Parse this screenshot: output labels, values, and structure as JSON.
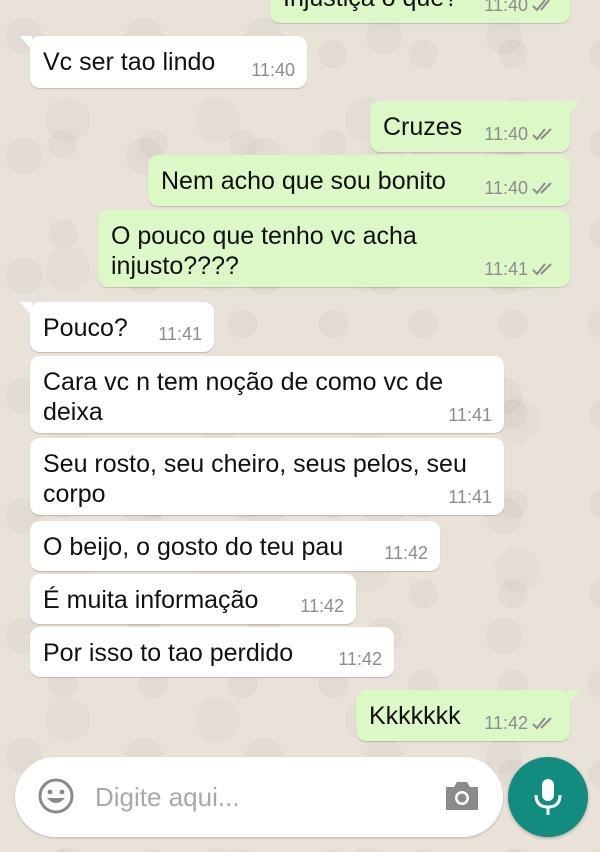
{
  "chat": {
    "messages": [
      {
        "direction": "out",
        "text": "Injustiça o que?",
        "time": "11:40",
        "status": "read"
      },
      {
        "direction": "in",
        "text": "Vc ser tao lindo",
        "time": "11:40"
      },
      {
        "direction": "out",
        "text": "Cruzes",
        "time": "11:40",
        "status": "read"
      },
      {
        "direction": "out",
        "text": "Nem acho que sou bonito",
        "time": "11:40",
        "status": "read"
      },
      {
        "direction": "out",
        "text": "O pouco que tenho vc acha injusto????",
        "line1": "O pouco que tenho vc acha",
        "line2": "injusto????",
        "time": "11:41",
        "status": "read"
      },
      {
        "direction": "in",
        "text": "Pouco?",
        "time": "11:41"
      },
      {
        "direction": "in",
        "text": "Cara vc n tem noção de como vc de deixa",
        "line1": "Cara vc n tem noção de como vc de",
        "line2": "deixa",
        "time": "11:41"
      },
      {
        "direction": "in",
        "text": "Seu rosto, seu cheiro, seus pelos, seu corpo",
        "line1": "Seu rosto, seu cheiro, seus pelos, seu",
        "line2": "corpo",
        "time": "11:41"
      },
      {
        "direction": "in",
        "text": "O beijo, o gosto do teu pau",
        "time": "11:42"
      },
      {
        "direction": "in",
        "text": "É muita informação",
        "time": "11:42"
      },
      {
        "direction": "in",
        "text": "Por isso to tao perdido",
        "time": "11:42"
      },
      {
        "direction": "out",
        "text": "Kkkkkkk",
        "time": "11:42",
        "status": "read"
      }
    ]
  },
  "composer": {
    "placeholder": "Digite aqui...",
    "emoji_icon": "emoji-icon",
    "camera_icon": "camera-icon",
    "mic_icon": "microphone-icon"
  },
  "colors": {
    "incoming_bubble": "#ffffff",
    "outgoing_bubble": "#dcf8c6",
    "mic_button": "#128c7e",
    "timestamp": "#8c8c8c"
  }
}
